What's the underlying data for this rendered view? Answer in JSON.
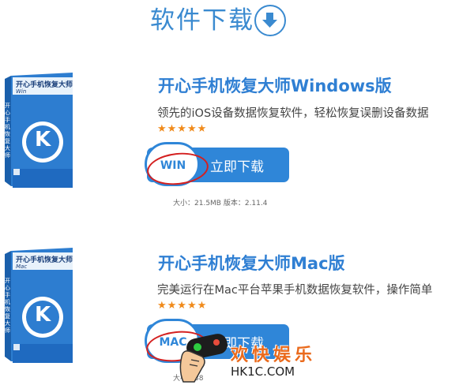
{
  "header": {
    "title": "软件下载",
    "icon": "download-arrow-icon",
    "accent": "#3a8ad0"
  },
  "products": {
    "windows": {
      "box_label": "开心手机恢复大师",
      "box_side_label": "开心手机恢复大师",
      "box_platform": "Win",
      "box_logo": "K",
      "title": "开心手机恢复大师Windows版",
      "description": "领先的iOS设备数据恢复软件，轻松恢复误删设备数据",
      "rating_stars": "★★★★★",
      "rating": 5,
      "button_os": "WIN",
      "button_label": "立即下载",
      "meta": "大小：21.5MB 版本：2.11.4"
    },
    "mac": {
      "box_label": "开心手机恢复大师",
      "box_side_label": "开心手机恢复大师",
      "box_platform": "Mac",
      "box_logo": "K",
      "title": "开心手机恢复大师Mac版",
      "description": "完美运行在Mac平台苹果手机数据恢复软件，操作简单",
      "rating_stars": "★★★★★",
      "rating": 5,
      "button_os": "MAC",
      "button_label": "立即下载",
      "meta": "大小：38"
    }
  },
  "watermark": {
    "text_cn": "欢快娱乐",
    "text_en": "HK1C.COM",
    "icon": "hand-holding-gamepad-icon"
  },
  "colors": {
    "title_blue": "#2f7fd3",
    "button_blue": "#2f86d8",
    "star_orange": "#f08a1a",
    "annotation_red": "#d42020"
  }
}
